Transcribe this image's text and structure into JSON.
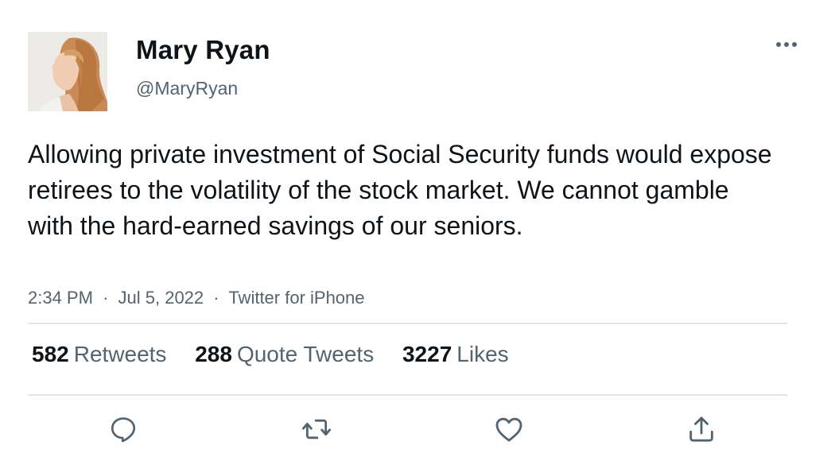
{
  "tweet": {
    "author_name": "Mary Ryan",
    "author_handle": "@MaryRyan",
    "text": "Allowing private investment of Social Security funds would expose retirees to the volatility of the stock market. We cannot gamble with the hard-earned savings of our seniors.",
    "time": "2:34 PM",
    "date": "Jul 5, 2022",
    "source": "Twitter for iPhone",
    "separator": "·"
  },
  "stats": {
    "retweets_count": "582",
    "retweets_label": "Retweets",
    "quotes_count": "288",
    "quotes_label": "Quote Tweets",
    "likes_count": "3227",
    "likes_label": "Likes"
  },
  "icons": {
    "more": "more-icon",
    "reply": "reply-icon",
    "retweet": "retweet-icon",
    "like": "like-icon",
    "share": "share-icon"
  },
  "colors": {
    "text_primary": "#0f1419",
    "text_secondary": "#536471",
    "icon": "#536471",
    "divider": "#e3e6e8"
  }
}
